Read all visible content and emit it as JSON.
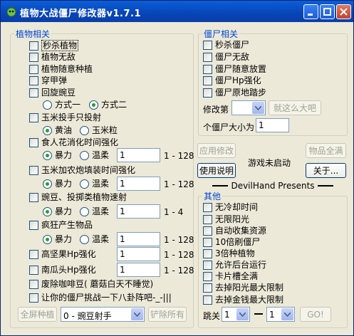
{
  "window": {
    "title": "植物大战僵尸修改器v1.7.1",
    "icon": "app-icon",
    "controls": [
      "minimize-icon",
      "maximize-icon",
      "close-icon"
    ],
    "accent": "#0a5fd8"
  },
  "plants": {
    "group_title": "植物相关",
    "instant_kill": "秒杀植物",
    "invincible": "植物无敌",
    "free_plant": "植物随意种植",
    "pierce": "穿甲弹",
    "rotate_peas": "回旋豌豆",
    "mode_one": "方式一",
    "mode_two": "方式二",
    "corn_launcher": "玉米投手只投射",
    "butter": "黄油",
    "kernel": "玉米粒",
    "chomper": "食人花消化时间强化",
    "violent1": "暴力",
    "gentle1": "温柔",
    "chomper_value": "1",
    "chomper_range": "1 - 128",
    "cob_cannon": "玉米加农炮填装时间强化",
    "violent2": "暴力",
    "gentle2": "温柔",
    "cob_value": "1",
    "cob_range": "1 - 128",
    "shooter_speed": "豌豆、投掷类植物速射",
    "violent3": "暴力",
    "gentle3": "温柔",
    "shooter_value": "1",
    "shooter_range": "1 - 4",
    "produce": "疯狂产生物品",
    "violent4": "暴力",
    "gentle4": "温柔",
    "produce_value": "1",
    "produce_range": "1 - 128",
    "tallnut_hp": "高坚果Hp强化",
    "tallnut_value": "1",
    "tallnut_range": "1 - 128",
    "pumpkin_hp": "南瓜头Hp强化",
    "pumpkin_value": "1",
    "pumpkin_range": "1 - 128",
    "coffee": "废除咖啡豆( 蘑菇白天不睡觉)",
    "gossip": "让你的僵尸挑战一下八卦阵吧-_-|||",
    "fill_btn": "全屏种植",
    "plant_select": "0 - 豌豆射手",
    "remove_btn": "铲除所有"
  },
  "zombies": {
    "group_title": "僵尸相关",
    "instant_kill": "秒杀僵尸",
    "invincible": "僵尸无敌",
    "free_place": "僵尸随意放置",
    "hp_boost": "僵尸Hp强化",
    "stand_still": "僵尸原地踏步",
    "modify_label": "修改第",
    "big_btn": "就这么大吧",
    "size_label": "个僵尸大小为",
    "size_value": "1"
  },
  "actions": {
    "apply": "应用修改",
    "status": "游戏未启动",
    "items_full": "物品全满",
    "help": "使用说明",
    "about": "关于...",
    "presents": "DevilHand Presents"
  },
  "other": {
    "group_title": "其他",
    "no_cooldown": "无冷却时间",
    "unlimited_sun": "无限阳光",
    "auto_collect": "自动收集资源",
    "ten_zombies": "10倍刷僵尸",
    "triple_plant": "3倍种植物",
    "background": "允许后台运行",
    "card_slot": "卡片槽全满",
    "sun_limit": "去掉阳光最大限制",
    "money_limit": "去掉金钱最大限制",
    "jump_label": "跳关",
    "level_a": "1",
    "level_b": "1",
    "go_btn": "GO!"
  }
}
